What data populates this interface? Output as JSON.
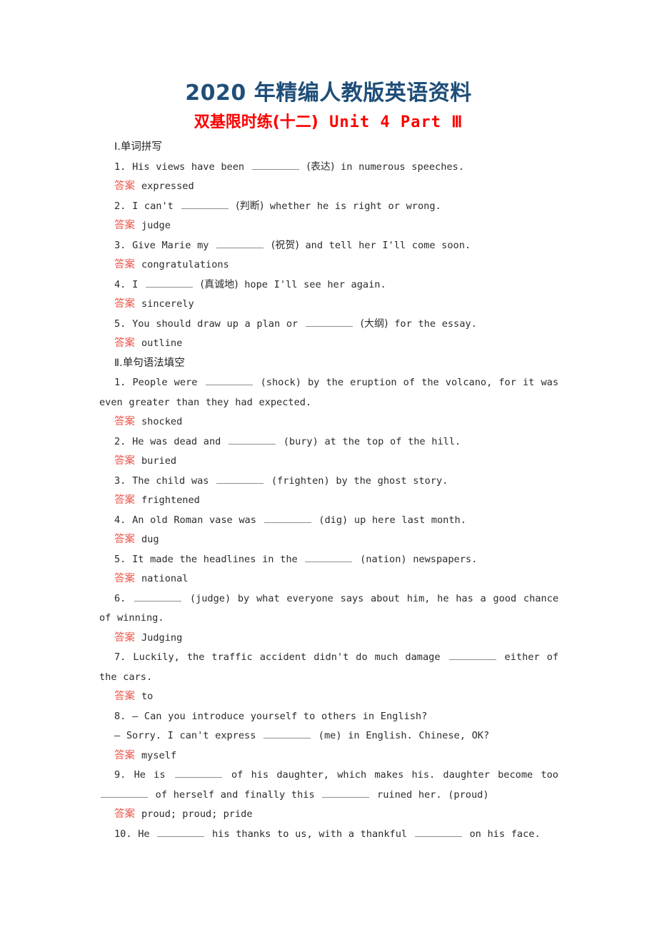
{
  "header": {
    "main_title": "2020 年精编人教版英语资料",
    "sub_title_cn": "双基限时练(十二)",
    "sub_title_en": "Unit 4  Part Ⅲ",
    "title_color": "#1f4e79",
    "sub_color": "#fc0000"
  },
  "answer_label": "答案",
  "answer_label_color": "#ef554a",
  "sections": [
    {
      "heading": "Ⅰ.单词拼写",
      "items": [
        {
          "number": "1.",
          "parts": [
            {
              "t": "text",
              "v": "His views have been "
            },
            {
              "t": "blank"
            },
            {
              "t": "text",
              "v": " "
            },
            {
              "t": "cn",
              "v": "(表达)"
            },
            {
              "t": "text",
              "v": " in numerous speeches."
            }
          ],
          "answer": "expressed"
        },
        {
          "number": "2.",
          "parts": [
            {
              "t": "text",
              "v": "I can't "
            },
            {
              "t": "blank"
            },
            {
              "t": "text",
              "v": " "
            },
            {
              "t": "cn",
              "v": "(判断)"
            },
            {
              "t": "text",
              "v": " whether he is right or wrong."
            }
          ],
          "answer": "judge"
        },
        {
          "number": "3.",
          "parts": [
            {
              "t": "text",
              "v": "Give Marie my "
            },
            {
              "t": "blank"
            },
            {
              "t": "text",
              "v": " "
            },
            {
              "t": "cn",
              "v": "(祝贺)"
            },
            {
              "t": "text",
              "v": " and tell her I'll come soon."
            }
          ],
          "answer": "congratulations"
        },
        {
          "number": "4.",
          "parts": [
            {
              "t": "text",
              "v": "I "
            },
            {
              "t": "blank"
            },
            {
              "t": "text",
              "v": " "
            },
            {
              "t": "cn",
              "v": "(真诚地)"
            },
            {
              "t": "text",
              "v": " hope I'll see her again."
            }
          ],
          "answer": "sincerely"
        },
        {
          "number": "5.",
          "parts": [
            {
              "t": "text",
              "v": "You should draw up a plan or "
            },
            {
              "t": "blank"
            },
            {
              "t": "text",
              "v": " "
            },
            {
              "t": "cn",
              "v": "(大纲)"
            },
            {
              "t": "text",
              "v": " for the essay."
            }
          ],
          "answer": "outline"
        }
      ]
    },
    {
      "heading": "Ⅱ.单句语法填空",
      "items": [
        {
          "number": "1.",
          "parts": [
            {
              "t": "text",
              "v": "People were "
            },
            {
              "t": "blank"
            },
            {
              "t": "text",
              "v": " (shock) by the eruption of the volcano, for it was even greater than they had expected."
            }
          ],
          "answer": "shocked"
        },
        {
          "number": "2.",
          "parts": [
            {
              "t": "text",
              "v": "He was dead and "
            },
            {
              "t": "blank"
            },
            {
              "t": "text",
              "v": " (bury) at the top of the hill."
            }
          ],
          "answer": "buried"
        },
        {
          "number": "3.",
          "parts": [
            {
              "t": "text",
              "v": "The child was "
            },
            {
              "t": "blank"
            },
            {
              "t": "text",
              "v": " (frighten) by the ghost story."
            }
          ],
          "answer": "frightened"
        },
        {
          "number": "4.",
          "parts": [
            {
              "t": "text",
              "v": "An old Roman vase was "
            },
            {
              "t": "blank"
            },
            {
              "t": "text",
              "v": " (dig) up here last month."
            }
          ],
          "answer": "dug"
        },
        {
          "number": "5.",
          "parts": [
            {
              "t": "text",
              "v": "It made the headlines in the "
            },
            {
              "t": "blank"
            },
            {
              "t": "text",
              "v": " (nation) newspapers."
            }
          ],
          "answer": "national"
        },
        {
          "number": "6.",
          "parts": [
            {
              "t": "text",
              "v": " "
            },
            {
              "t": "blank"
            },
            {
              "t": "text",
              "v": " (judge) by what everyone says about him, he has a good chance of winning."
            }
          ],
          "answer": "Judging"
        },
        {
          "number": "7.",
          "parts": [
            {
              "t": "text",
              "v": "Luckily, the traffic accident didn't do much damage "
            },
            {
              "t": "blank"
            },
            {
              "t": "text",
              "v": " either of the cars."
            }
          ],
          "answer": "to"
        },
        {
          "number": "8.",
          "line1": "— Can you introduce yourself to others in English?",
          "parts": [
            {
              "t": "text",
              "v": "— Sorry. I can't express "
            },
            {
              "t": "blank"
            },
            {
              "t": "text",
              "v": " (me) in English. Chinese, OK?"
            }
          ],
          "answer": "myself"
        },
        {
          "number": "9.",
          "parts": [
            {
              "t": "text",
              "v": "He is "
            },
            {
              "t": "blank"
            },
            {
              "t": "text",
              "v": " of his daughter, which makes his. daughter become too "
            },
            {
              "t": "blank"
            },
            {
              "t": "text",
              "v": " of herself and finally this "
            },
            {
              "t": "blank"
            },
            {
              "t": "text",
              "v": " ruined her. (proud)"
            }
          ],
          "answer": "proud; proud; pride"
        },
        {
          "number": "10.",
          "parts": [
            {
              "t": "text",
              "v": "He "
            },
            {
              "t": "blank"
            },
            {
              "t": "text",
              "v": " his thanks to us, with a thankful "
            },
            {
              "t": "blank"
            },
            {
              "t": "text",
              "v": " on his face."
            }
          ],
          "answer": null
        }
      ]
    }
  ]
}
